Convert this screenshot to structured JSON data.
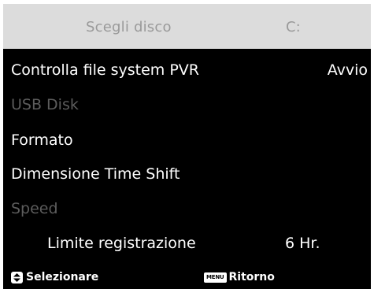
{
  "header": {
    "title": "Scegli disco",
    "drive": "C:"
  },
  "menu": {
    "items": [
      {
        "label": "Controlla file system PVR",
        "value": "Avvio",
        "enabled": true
      },
      {
        "label": "USB Disk",
        "value": "",
        "enabled": false
      },
      {
        "label": "Formato",
        "value": "",
        "enabled": true
      },
      {
        "label": "Dimensione Time Shift",
        "value": "",
        "enabled": true
      },
      {
        "label": "Speed",
        "value": "",
        "enabled": false
      },
      {
        "label": "Limite registrazione",
        "value": "6 Hr.",
        "enabled": true
      }
    ]
  },
  "footer": {
    "select_label": "Selezionare",
    "select_icon": "up-down-arrows-icon",
    "back_label": "Ritorno",
    "back_icon": "menu-button-icon",
    "menu_icon_text": "MENU"
  },
  "colors": {
    "background": "#000000",
    "header_bg": "#dcdcdc",
    "header_text": "#9a9a9a",
    "text": "#ffffff",
    "disabled_text": "#5c5c5c"
  }
}
